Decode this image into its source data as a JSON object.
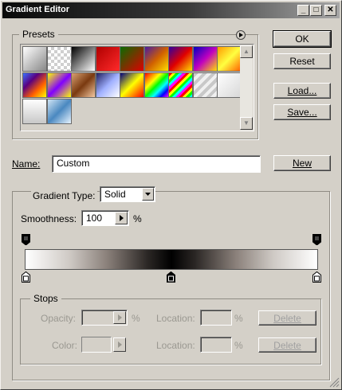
{
  "window": {
    "title": "Gradient Editor",
    "min_label": "_",
    "max_label": "□",
    "close_label": "✕"
  },
  "buttons": {
    "ok": "OK",
    "reset": "Reset",
    "load": "Load...",
    "save": "Save...",
    "new": "New"
  },
  "presets": {
    "label": "Presets",
    "menu_icon": "circle-arrow-icon",
    "swatches": [
      "linear-gradient(135deg,#ffffff,#888888)",
      "repeating-conic-gradient(#cfcfcf 0 25%,#ffffff 0 50%) 0 0/8px 8px",
      "linear-gradient(135deg,#000000,#ffffff)",
      "linear-gradient(135deg,#b00000,#ff2a2a)",
      "linear-gradient(135deg,#0a6b00,#e00000)",
      "linear-gradient(135deg,#4a1aa0,#d06000,#ffe000)",
      "linear-gradient(135deg,#3000a0,#e00000,#ffe000)",
      "linear-gradient(135deg,#0000c0,#c000c0,#ffe000)",
      "linear-gradient(135deg,#ff9a00,#ffff40,#ff6000)",
      "linear-gradient(135deg,#3a70ff,#5a0080,#ff6000,#ffff00)",
      "linear-gradient(135deg,#ffff00,#8000ff,#ffff00)",
      "linear-gradient(135deg,#d8a070,#7a3a10,#f4c8a0)",
      "linear-gradient(135deg,#202060,#a0b0ff,#ffffff)",
      "linear-gradient(135deg,#000080,#ffff00,#ff0000)",
      "linear-gradient(135deg,#ff0000,#ff8000,#ffff00,#00ff00,#00ffff,#0000ff,#ff00ff)",
      "repeating-linear-gradient(135deg,#ff0000 0 3px,#ffff00 3px 6px,#00ff00 6px 9px,#00ffff 9px 12px,#ff00ff 12px 15px)",
      "repeating-linear-gradient(135deg,#c8c8c8 0 4px,#f0f0f0 4px 8px)",
      "linear-gradient(135deg,#ffffff,#d8d8d8)",
      "linear-gradient(180deg,#ffffff,#c8c8c8)",
      "linear-gradient(135deg,#d0e4f4,#4a88c0,#e8f4ff)"
    ],
    "scroll_up": "▲",
    "scroll_down": "▼"
  },
  "name_field": {
    "label": "Name:",
    "value": "Custom"
  },
  "gradient": {
    "type_label": "Gradient Type:",
    "type_value": "Solid",
    "smoothness_label": "Smoothness:",
    "smoothness_value": "100",
    "percent": "%",
    "bar_gradient": "linear-gradient(to right,#ffffff 0%,#cfcac5 15%,#8a807a 28%,#2a2624 42%,#000000 50%,#2a2624 58%,#8a807a 72%,#cfcac5 85%,#ffffff 100%)"
  },
  "stops": {
    "label": "Stops",
    "opacity_label": "Opacity:",
    "opacity_unit": "%",
    "color_label": "Color:",
    "location_label": "Location:",
    "location_unit": "%",
    "delete_label": "Delete"
  }
}
